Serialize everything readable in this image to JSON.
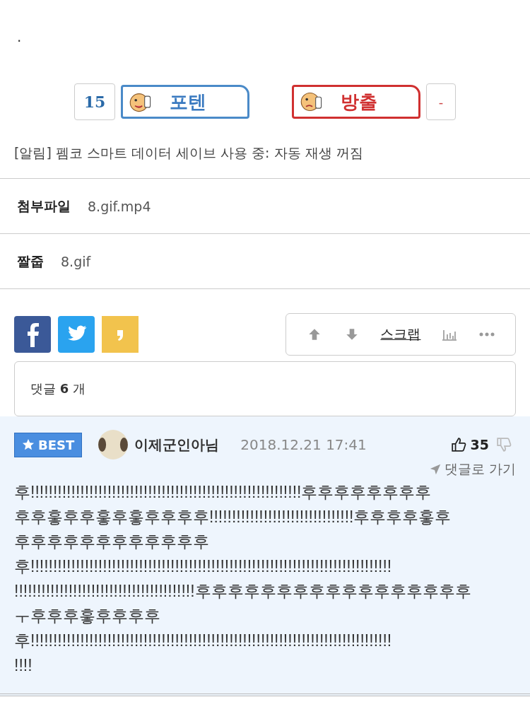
{
  "top_mark": ".",
  "vote": {
    "count": "15",
    "up_label": "포텐",
    "down_label": "방출",
    "down_count": "-"
  },
  "notice": "[알림] 펨코 스마트 데이터 세이브 사용 중: 자동 재생 꺼짐",
  "attachments": [
    {
      "label": "첨부파일",
      "value": "8.gif.mp4"
    },
    {
      "label": "짤줍",
      "value": "8.gif"
    }
  ],
  "share": [
    {
      "kind": "facebook"
    },
    {
      "kind": "twitter"
    },
    {
      "kind": "kakao"
    }
  ],
  "toolbar": {
    "scrap": "스크랩"
  },
  "comments_count": "댓글 **6** 개",
  "comment": {
    "badge": "BEST",
    "author": "이제군인아님",
    "date": "2018.12.21 17:41",
    "likes": "35",
    "goto": "댓글로 가기",
    "text": "후!!!!!!!!!!!!!!!!!!!!!!!!!!!!!!!!!!!!!!!!!!!!!!!!!!!!!!!!!!!!후후후후후후후후\n후후훟후후훟후훟후후후후!!!!!!!!!!!!!!!!!!!!!!!!!!!!!!!!후후후후훟후\n후후후후후후후후후후후후\n후!!!!!!!!!!!!!!!!!!!!!!!!!!!!!!!!!!!!!!!!!!!!!!!!!!!!!!!!!!!!!!!!!!!!!!!!!!!!!!!!\n!!!!!!!!!!!!!!!!!!!!!!!!!!!!!!!!!!!!!!!!후후후후후후후후후후후후후후후후후\nㅜ후후후훟후후후후\n후!!!!!!!!!!!!!!!!!!!!!!!!!!!!!!!!!!!!!!!!!!!!!!!!!!!!!!!!!!!!!!!!!!!!!!!!!!!!!!!!\n!!!!"
  }
}
